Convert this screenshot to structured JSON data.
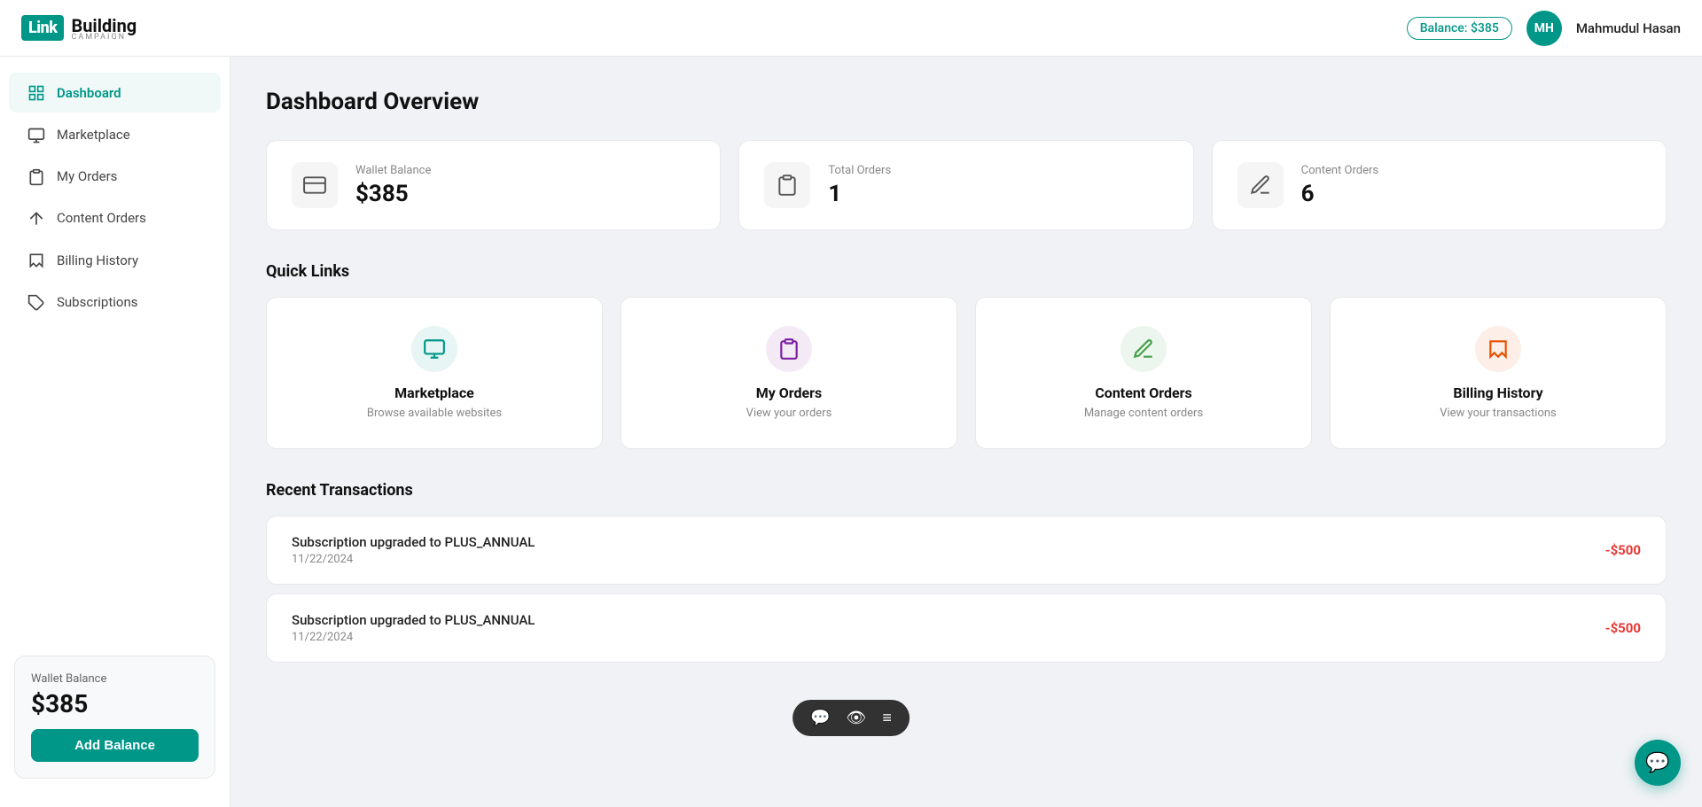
{
  "header": {
    "logo_link": "Link",
    "logo_building": "Building",
    "logo_campaign": "CAMPAIGN",
    "balance_label": "Balance: $385",
    "avatar_initials": "MH",
    "user_name": "Mahmudul Hasan"
  },
  "sidebar": {
    "items": [
      {
        "id": "dashboard",
        "label": "Dashboard",
        "icon": "grid"
      },
      {
        "id": "marketplace",
        "label": "Marketplace",
        "icon": "monitor"
      },
      {
        "id": "my-orders",
        "label": "My Orders",
        "icon": "clipboard"
      },
      {
        "id": "content-orders",
        "label": "Content Orders",
        "icon": "pen"
      },
      {
        "id": "billing-history",
        "label": "Billing History",
        "icon": "receipt"
      },
      {
        "id": "subscriptions",
        "label": "Subscriptions",
        "icon": "tag"
      }
    ],
    "wallet": {
      "label": "Wallet Balance",
      "amount": "$385",
      "button_label": "Add Balance"
    }
  },
  "main": {
    "page_title": "Dashboard Overview",
    "stats": [
      {
        "label": "Wallet Balance",
        "value": "$385",
        "icon": "wallet"
      },
      {
        "label": "Total Orders",
        "value": "1",
        "icon": "orders"
      },
      {
        "label": "Content Orders",
        "value": "6",
        "icon": "pen"
      }
    ],
    "quick_links_title": "Quick Links",
    "quick_links": [
      {
        "title": "Marketplace",
        "subtitle": "Browse available websites",
        "icon": "monitor",
        "color": "#009688"
      },
      {
        "title": "My Orders",
        "subtitle": "View your orders",
        "icon": "clipboard",
        "color": "#7b1fa2"
      },
      {
        "title": "Content Orders",
        "subtitle": "Manage content orders",
        "icon": "pen",
        "color": "#43a047"
      },
      {
        "title": "Billing History",
        "subtitle": "View your transactions",
        "icon": "receipt",
        "color": "#e65100"
      }
    ],
    "transactions_title": "Recent Transactions",
    "transactions": [
      {
        "title": "Subscription upgraded to PLUS_ANNUAL",
        "date": "11/22/2024",
        "amount": "-$500",
        "type": "negative"
      },
      {
        "title": "Subscription upgraded to PLUS_ANNUAL",
        "date": "11/22/2024",
        "amount": "-$500",
        "type": "negative"
      }
    ]
  },
  "floating_toolbar": {
    "icons": [
      "chat",
      "eye",
      "menu"
    ]
  }
}
